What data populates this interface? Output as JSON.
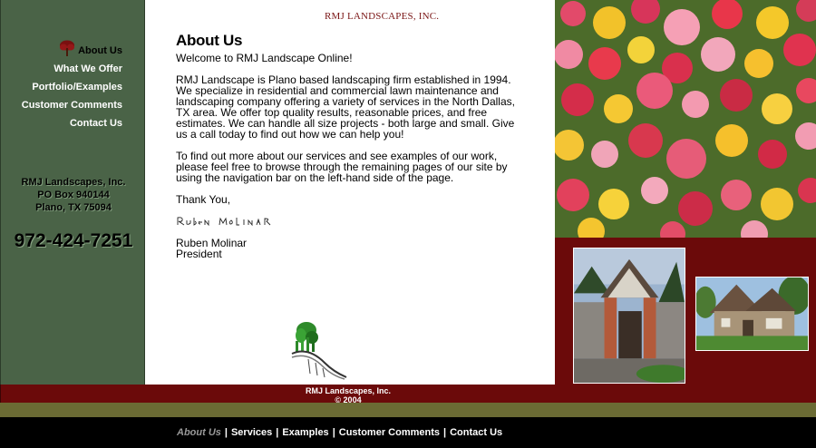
{
  "sidebar": {
    "nav": [
      {
        "label": "About Us",
        "active": true
      },
      {
        "label": "What We Offer"
      },
      {
        "label": "Portfolio/Examples"
      },
      {
        "label": "Customer Comments"
      },
      {
        "label": "Contact Us"
      }
    ],
    "address": {
      "company": "RMJ Landscapes, Inc.",
      "po_box": "PO Box 940144",
      "city": "Plano, TX 75094"
    },
    "phone": "972-424-7251"
  },
  "content": {
    "title": "About Us",
    "welcome": "Welcome to RMJ Landscape Online!",
    "para1": "RMJ Landscape is Plano based landscaping firm established in 1994. We specialize in residential and commercial lawn maintenance and landscaping company offering a variety of services in the North Dallas, TX area. We offer top quality results, reasonable prices, and free estimates. We can handle all size projects - both large and small. Give us a call today to find out how we can help you!",
    "para2": "To find out more about our services and see examples of our work, please feel free to browse through the remaining pages of our site by using the navigation bar on the left-hand side of the page.",
    "closing": "Thank You,",
    "signature_text": "Ruben Molinar",
    "name": "Ruben Molinar",
    "role": "President"
  },
  "logo": {
    "text": "RMJ LANDSCAPES, INC."
  },
  "footer": {
    "company": "RMJ Landscapes, Inc.",
    "copyright": "© 2004"
  },
  "bottom_nav": [
    {
      "label": "About Us",
      "active": true
    },
    {
      "label": "Services"
    },
    {
      "label": "Examples"
    },
    {
      "label": "Customer Comments"
    },
    {
      "label": "Contact Us"
    }
  ],
  "colors": {
    "sidebar_green": "#4a6347",
    "maroon": "#6b0a0a",
    "olive": "#6b6b34"
  }
}
